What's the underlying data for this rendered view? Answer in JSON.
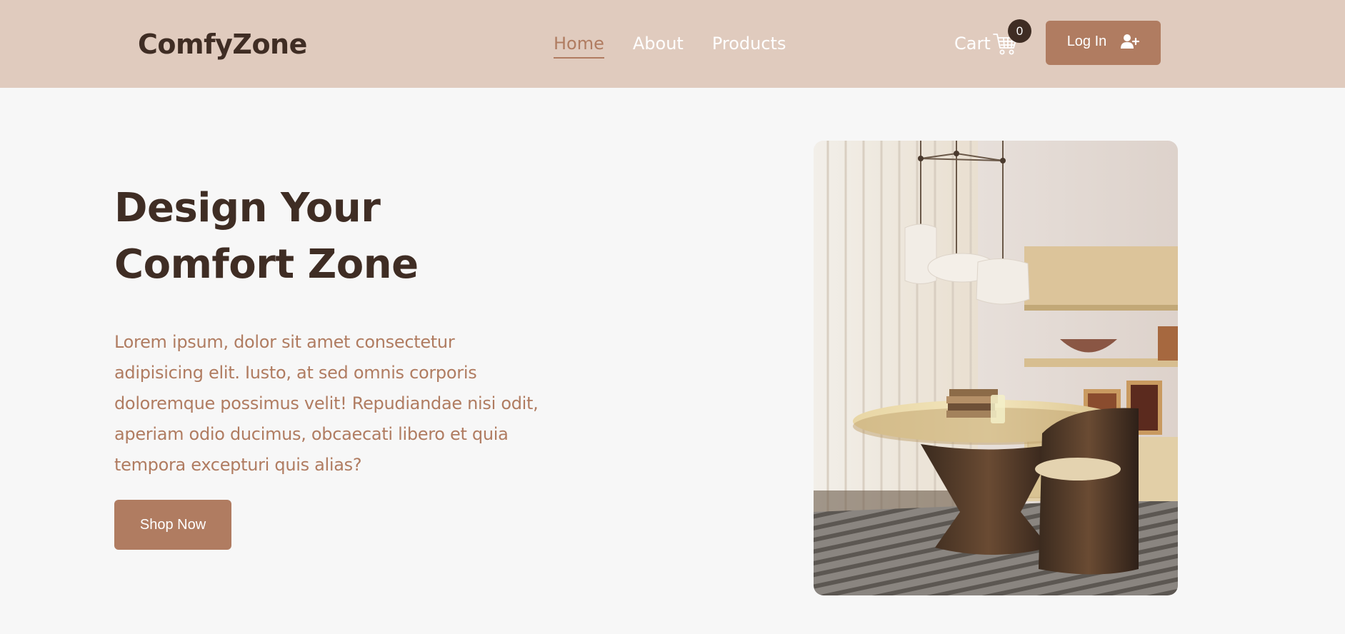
{
  "brand": {
    "name": "ComfyZone"
  },
  "nav": {
    "links": [
      {
        "label": "Home",
        "active": true
      },
      {
        "label": "About",
        "active": false
      },
      {
        "label": "Products",
        "active": false
      }
    ],
    "cart_label": "Cart",
    "cart_count": "0",
    "login_label": "Log In"
  },
  "hero": {
    "title_line1": "Design Your",
    "title_line2": "Comfort Zone",
    "text": "Lorem ipsum, dolor sit amet consectetur adipisicing elit. Iusto, at sed omnis corporis doloremque possimus velit! Repudiandae nisi odit, aperiam odio ducimus, obcaecati libero et quia tempora excepturi quis alias?",
    "cta_label": "Shop Now"
  },
  "colors": {
    "navbar_bg": "#e0cbbe",
    "primary": "#b07c61",
    "dark": "#3f2d24",
    "page_bg": "#f7f7f7"
  },
  "icons": {
    "cart": "shopping-cart-icon",
    "login": "user-plus-icon"
  }
}
